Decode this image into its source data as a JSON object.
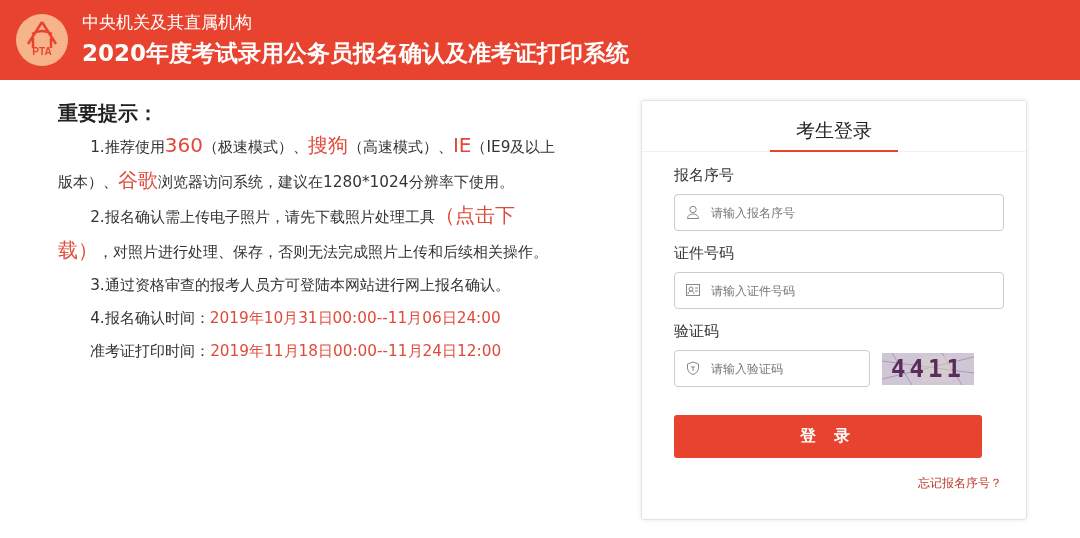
{
  "header": {
    "logo_text": "PTA",
    "subtitle": "中央机关及其直属机构",
    "title": "2020年度考试录用公务员报名确认及准考证打印系统"
  },
  "notice": {
    "heading": "重要提示：",
    "paragraphs": [
      {
        "segments": [
          {
            "text": "1.推荐使用",
            "highlight": false
          },
          {
            "text": "360",
            "highlight": true
          },
          {
            "text": "（极速模式）、",
            "highlight": false
          },
          {
            "text": "搜狗",
            "highlight": true
          },
          {
            "text": "（高速模式）、",
            "highlight": false
          },
          {
            "text": "IE",
            "highlight": true
          },
          {
            "text": "（IE9及以上版本）、",
            "highlight": false
          },
          {
            "text": "谷歌",
            "highlight": true
          },
          {
            "text": "浏览器访问系统，建议在1280*1024分辨率下使用。",
            "highlight": false
          }
        ]
      },
      {
        "segments": [
          {
            "text": "2.报名确认需上传电子照片，请先下载照片处理工具",
            "highlight": false
          },
          {
            "text": "（点击下载）",
            "highlight": true
          },
          {
            "text": "，对照片进行处理、保存，否则无法完成照片上传和后续相关操作。",
            "highlight": false
          }
        ]
      },
      {
        "segments": [
          {
            "text": "3.通过资格审查的报考人员方可登陆本网站进行网上报名确认。",
            "highlight": false
          }
        ]
      },
      {
        "label": "4.报名确认时间：",
        "time": "2019年10月31日00:00--11月06日24:00"
      },
      {
        "label": "准考证打印时间：",
        "time": "2019年11月18日00:00--11月24日12:00"
      }
    ]
  },
  "login": {
    "title": "考生登录",
    "fields": [
      {
        "kind": "user",
        "label": "报名序号",
        "placeholder": "请输入报名序号"
      },
      {
        "kind": "id",
        "label": "证件号码",
        "placeholder": "请输入证件号码"
      },
      {
        "kind": "captcha",
        "label": "验证码",
        "placeholder": "请输入验证码",
        "captcha": "4411"
      }
    ],
    "button": "登 录",
    "forgot_link": "忘记报名序号？"
  }
}
